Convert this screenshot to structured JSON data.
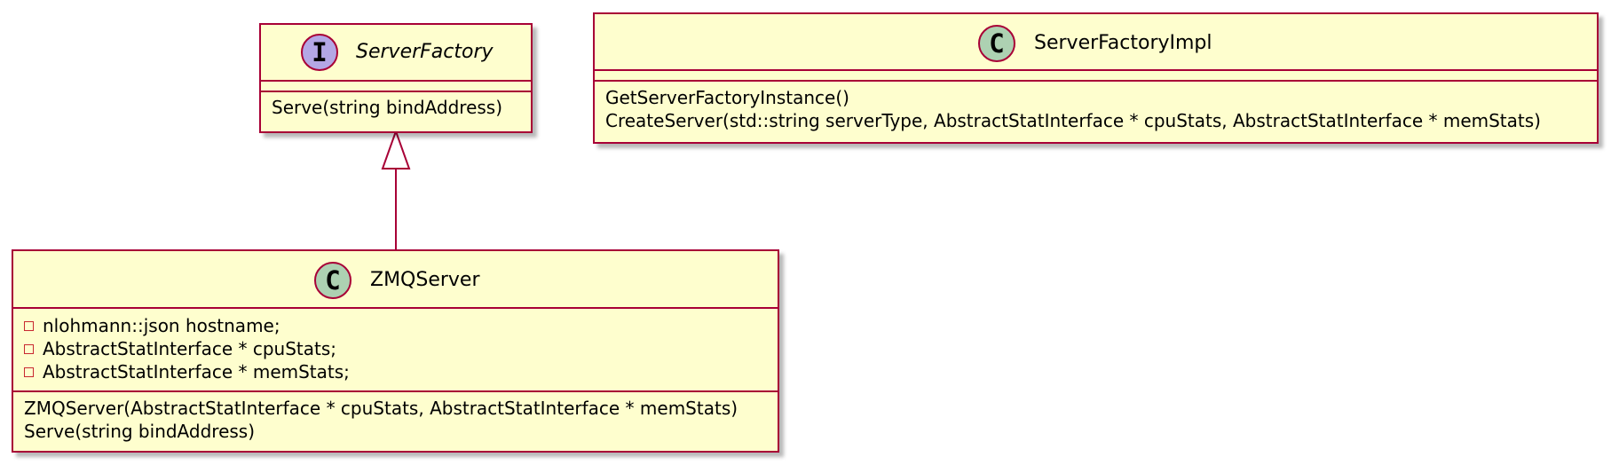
{
  "classes": {
    "server_factory": {
      "name": "ServerFactory",
      "stereotype_letter": "I",
      "kind_icon": "interface-icon",
      "methods": [
        "Serve(string bindAddress)"
      ]
    },
    "server_factory_impl": {
      "name": "ServerFactoryImpl",
      "stereotype_letter": "C",
      "kind_icon": "class-icon",
      "methods": [
        "GetServerFactoryInstance()",
        "CreateServer(std::string serverType, AbstractStatInterface * cpuStats, AbstractStatInterface * memStats)"
      ]
    },
    "zmq_server": {
      "name": "ZMQServer",
      "stereotype_letter": "C",
      "kind_icon": "class-icon",
      "fields": [
        "nlohmann::json hostname;",
        "AbstractStatInterface * cpuStats;",
        "AbstractStatInterface * memStats;"
      ],
      "field_visibility": "private",
      "methods": [
        "ZMQServer(AbstractStatInterface * cpuStats, AbstractStatInterface * memStats)",
        "Serve(string bindAddress)"
      ]
    }
  },
  "relations": [
    {
      "from": "ZMQServer",
      "to": "ServerFactory",
      "type": "realization",
      "arrow_icon": "hollow-triangle-icon"
    }
  ],
  "colors": {
    "class_fill": "#FEFECE",
    "border": "#A80036",
    "interface_badge": "#B4A7E5",
    "class_badge": "#ADD1B2",
    "private_marker": "#C82930"
  }
}
